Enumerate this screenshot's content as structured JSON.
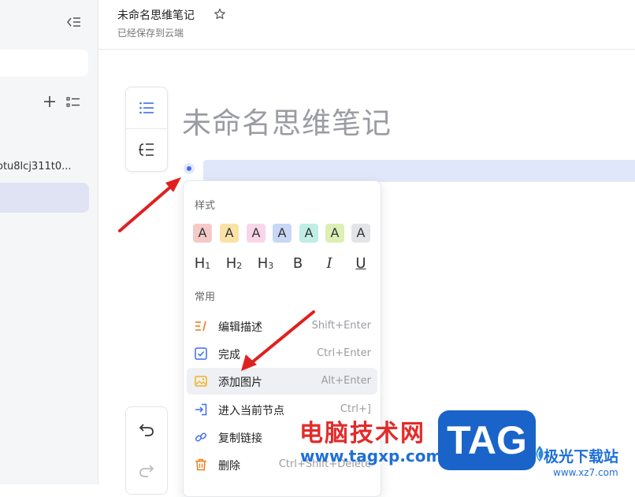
{
  "sidebar": {
    "item_partial_label": "otu8lcj311t0..."
  },
  "header": {
    "title": "未命名思维笔记",
    "save_status": "已经保存到云端"
  },
  "editor": {
    "note_title": "未命名思维笔记"
  },
  "menu": {
    "section_style": "样式",
    "swatch_letter": "A",
    "swatch_colors": [
      "#f6c9c9",
      "#f9e2a6",
      "#f8d6ea",
      "#c9d6f5",
      "#bfeee6",
      "#dcefb5",
      "#e3e4e7"
    ],
    "format": {
      "h1": "H",
      "h1_sub": "1",
      "h2": "H",
      "h2_sub": "2",
      "h3": "H",
      "h3_sub": "3",
      "bold": "B",
      "italic": "I",
      "underline": "U"
    },
    "section_common": "常用",
    "items": [
      {
        "label": "编辑描述",
        "shortcut": "Shift+Enter",
        "icon": "edit-description-icon",
        "color": "#f07d1f"
      },
      {
        "label": "完成",
        "shortcut": "Ctrl+Enter",
        "icon": "checkbox-icon",
        "color": "#3d6cf0"
      },
      {
        "label": "添加图片",
        "shortcut": "Alt+Enter",
        "icon": "image-icon",
        "color": "#f0b31f"
      },
      {
        "label": "进入当前节点",
        "shortcut": "Ctrl+]",
        "icon": "enter-node-icon",
        "color": "#3d6cf0"
      },
      {
        "label": "复制链接",
        "shortcut": "",
        "icon": "link-icon",
        "color": "#3d6cf0"
      },
      {
        "label": "删除",
        "shortcut": "Ctrl+Shift+Delete",
        "icon": "trash-icon",
        "color": "#f07d1f"
      }
    ]
  },
  "watermark": {
    "site_name": "电脑技术网",
    "site_url": "www.tagxp.com",
    "tag_text": "TAG",
    "jg_name": "极光下载站",
    "jg_url": "www.xz7.com"
  },
  "colors": {
    "accent": "#3d6cf0",
    "arrow_red": "#e02020"
  }
}
